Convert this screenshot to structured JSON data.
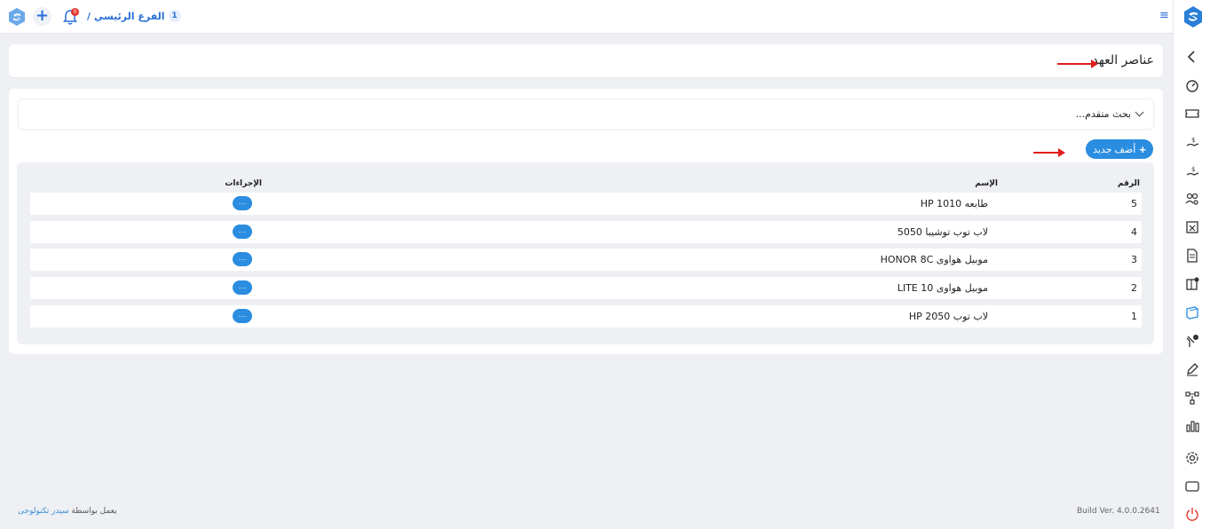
{
  "topbar": {
    "notification_count": "0",
    "add_symbol": "+",
    "branch_label": "الفرع الرئيسي /",
    "branch_number": "1",
    "menu_symbol": "≡"
  },
  "page": {
    "title": "عناصر العهد"
  },
  "search": {
    "label": "بحث متقدم..."
  },
  "toolbar": {
    "add_label": "أضف جديد",
    "add_symbol": "+"
  },
  "table": {
    "headers": {
      "number": "الرقم",
      "name": "الإسم",
      "actions": "الإجراءات"
    },
    "action_label": "···",
    "rows": [
      {
        "number": "5",
        "name": "طابعه HP 1010"
      },
      {
        "number": "4",
        "name": "لاب توب توشيبا 5050"
      },
      {
        "number": "3",
        "name": "موبيل هواوى HONOR 8C"
      },
      {
        "number": "2",
        "name": "موبيل هواوى LITE 10"
      },
      {
        "number": "1",
        "name": "لاب توب HP 2050"
      }
    ]
  },
  "footer": {
    "powered_by": "يعمل بواسطة",
    "company": "سيدر تكنولوجى",
    "build": "Build Ver. 4.0.0.2641"
  },
  "colors": {
    "accent": "#2a8de0",
    "annotation_arrow": "#e01c1c",
    "power_icon": "#e3342f"
  }
}
